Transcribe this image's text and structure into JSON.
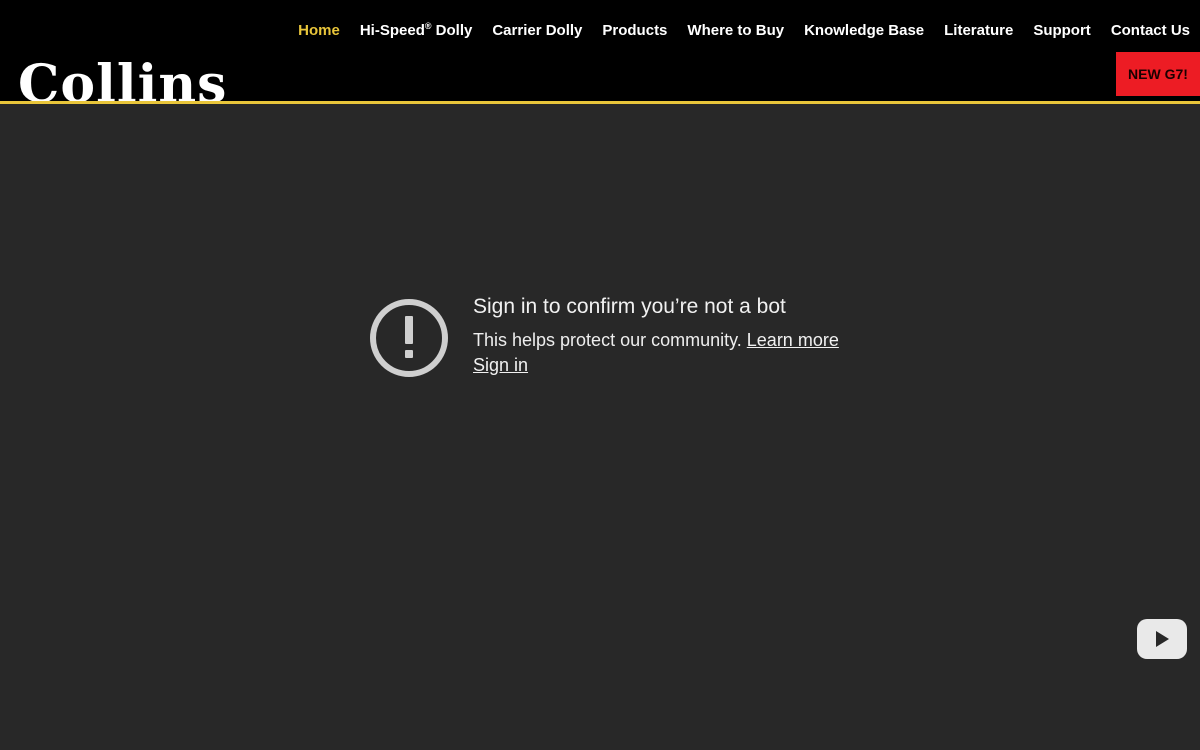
{
  "header": {
    "logo_text": "Collins",
    "new_button_label": "NEW G7!",
    "accent_color": "#e8c53a",
    "new_button_color": "#ed1c24"
  },
  "nav": {
    "items": [
      {
        "label": "Home",
        "active": true
      },
      {
        "label": "Hi-Speed",
        "sup": "®",
        "label_suffix": " Dolly"
      },
      {
        "label": "Carrier Dolly"
      },
      {
        "label": "Products"
      },
      {
        "label": "Where to Buy"
      },
      {
        "label": "Knowledge Base"
      },
      {
        "label": "Literature"
      },
      {
        "label": "Support"
      },
      {
        "label": "Contact Us"
      }
    ]
  },
  "player": {
    "background_color": "#282828",
    "icon": "exclamation-circle-icon",
    "title": "Sign in to confirm you’re not a bot",
    "body_text": "This helps protect our community. ",
    "learn_more_link": "Learn more",
    "sign_in_link": "Sign in",
    "watermark_icon": "youtube-play-icon"
  }
}
